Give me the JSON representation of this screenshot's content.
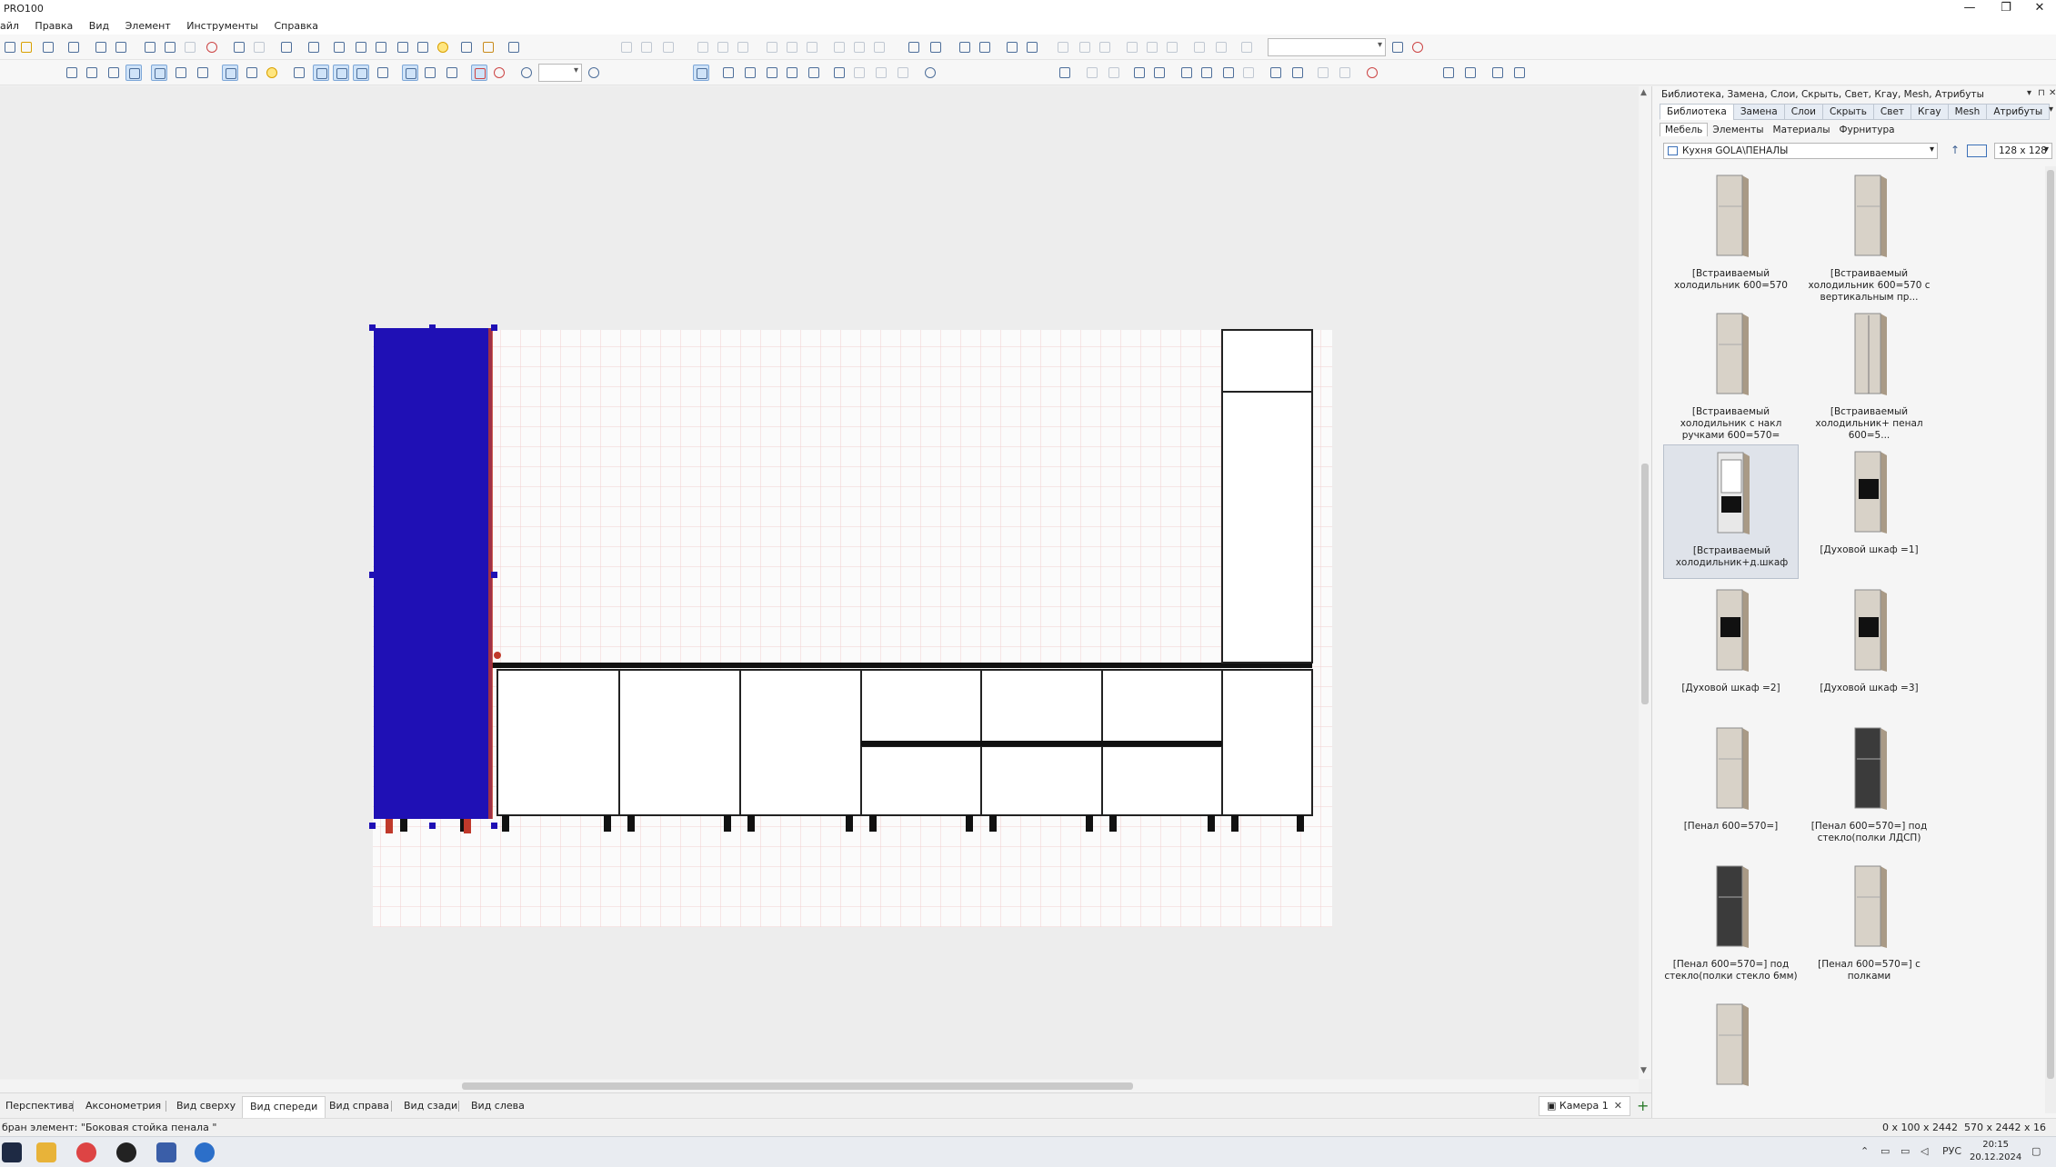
{
  "window": {
    "title": "PRO100",
    "controls": [
      "—",
      "❐",
      "✕"
    ]
  },
  "menu": [
    "айл",
    "Правка",
    "Вид",
    "Элемент",
    "Инструменты",
    "Справка"
  ],
  "view_tabs": [
    "Перспектива",
    "Аксонометрия",
    "Вид сверху",
    "Вид спереди",
    "Вид справа",
    "Вид сзади",
    "Вид слева"
  ],
  "active_view_tab": "Вид спереди",
  "camera_tab": "Камера 1",
  "status": {
    "message": "бран элемент: \"Боковая стойка пенала \"",
    "dims_a": "0 x 100 x 2442",
    "dims_b": "570 x 2442 x 16"
  },
  "taskbar": {
    "lang": "РУС",
    "time": "20:15",
    "date": "20.12.2024"
  },
  "panel": {
    "title": "Библиотека, Замена, Слои, Скрыть, Свет, Кгау, Mesh, Атрибуты",
    "tabs": [
      "Библиотека",
      "Замена",
      "Слои",
      "Скрыть",
      "Свет",
      "Кгау",
      "Mesh",
      "Атрибуты"
    ],
    "active_tab": "Библиотека",
    "subtabs": [
      "Мебель",
      "Элементы",
      "Материалы",
      "Фурнитура"
    ],
    "active_subtab": "Мебель",
    "path": "Кухня GOLA\\ПЕНАЛЫ",
    "thumb_size": "128 x 128",
    "items": [
      {
        "label": "[Встраиваемый холодильник 600=570",
        "style": "fridge",
        "selected": false
      },
      {
        "label": "[Встраиваемый холодильник 600=570 с вертикальным пр...",
        "style": "fridge",
        "selected": false
      },
      {
        "label": "[Встраиваемый холодильник с накл ручками 600=570=",
        "style": "fridge",
        "selected": false
      },
      {
        "label": "[Встраиваемый холодильник+ пенал 600=5...",
        "style": "fridge2",
        "selected": false
      },
      {
        "label": "[Встраиваемый холодильник+д.шкаф",
        "style": "open",
        "selected": true
      },
      {
        "label": "[Духовой шкаф =1]",
        "style": "oven",
        "selected": false
      },
      {
        "label": "[Духовой шкаф =2]",
        "style": "oven",
        "selected": false
      },
      {
        "label": "[Духовой шкаф =3]",
        "style": "oven",
        "selected": false
      },
      {
        "label": "[Пенал 600=570=]",
        "style": "fridge",
        "selected": false
      },
      {
        "label": "[Пенал 600=570=] под стекло(полки ЛДСП)",
        "style": "dark",
        "selected": false
      },
      {
        "label": "[Пенал 600=570=] под стекло(полки стекло 6мм)",
        "style": "dark",
        "selected": false
      },
      {
        "label": "[Пенал 600=570=] с полками",
        "style": "fridge",
        "selected": false
      },
      {
        "label": "",
        "style": "fridge",
        "selected": false
      }
    ]
  },
  "colors": {
    "selection": "#1f10b5",
    "grid": "#f2cfcf",
    "cabinet_line": "#111111",
    "accent": "#c0392b"
  }
}
